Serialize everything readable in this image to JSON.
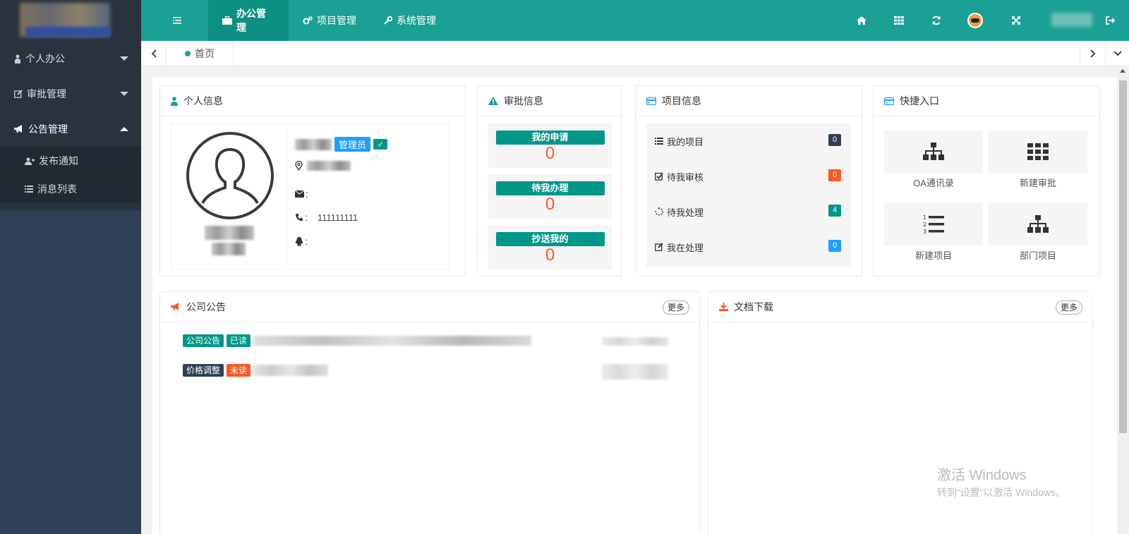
{
  "header": {
    "menu_icon": "hamburger-icon",
    "tabs": [
      {
        "label": "办公管理",
        "icon": "briefcase-icon",
        "active": true
      },
      {
        "label": "项目管理",
        "icon": "gears-icon",
        "active": false
      },
      {
        "label": "系统管理",
        "icon": "wrench-icon",
        "active": false
      }
    ],
    "tools": [
      "home-icon",
      "grid-icon",
      "refresh-icon",
      "avatar",
      "fullscreen-icon",
      "logout-icon"
    ]
  },
  "sidebar": {
    "items": [
      {
        "label": "个人办公",
        "icon": "person-icon",
        "expanded": false
      },
      {
        "label": "审批管理",
        "icon": "edit-icon",
        "expanded": false
      },
      {
        "label": "公告管理",
        "icon": "bullhorn-icon",
        "expanded": true
      }
    ],
    "subitems": [
      {
        "label": "发布通知",
        "icon": "user-plus-icon"
      },
      {
        "label": "消息列表",
        "icon": "list-icon"
      }
    ]
  },
  "tabbar": {
    "home": "首页"
  },
  "personal": {
    "title": "个人信息",
    "role_badge": "管理员",
    "gender_badge": "♂",
    "email_label": ":",
    "phone_label": ":",
    "phone": "111111111",
    "qq_label": ":"
  },
  "approval": {
    "title": "审批信息",
    "items": [
      {
        "label": "我的申请",
        "count": "0"
      },
      {
        "label": "待我办理",
        "count": "0"
      },
      {
        "label": "抄送我的",
        "count": "0"
      }
    ]
  },
  "project": {
    "title": "项目信息",
    "items": [
      {
        "label": "我的项目",
        "count": "0",
        "color": "#2f4056"
      },
      {
        "label": "待我审核",
        "count": "0",
        "color": "#ff5722"
      },
      {
        "label": "待我处理",
        "count": "4",
        "color": "#009688"
      },
      {
        "label": "我在处理",
        "count": "0",
        "color": "#1e9fff"
      }
    ]
  },
  "quick": {
    "title": "快捷入口",
    "items": [
      {
        "label": "OA通讯录",
        "icon": "org-chart-icon"
      },
      {
        "label": "新建审批",
        "icon": "grid-icon"
      },
      {
        "label": "新建项目",
        "icon": "ordered-list-icon"
      },
      {
        "label": "部门项目",
        "icon": "org-chart-icon"
      }
    ]
  },
  "notices": {
    "title": "公司公告",
    "more": "更多",
    "rows": [
      {
        "category": "公司公告",
        "category_color": "#009688",
        "status": "已读",
        "status_color": "#009688"
      },
      {
        "category": "价格调整",
        "category_color": "#2f4056",
        "status": "未读",
        "status_color": "#ff5722"
      }
    ]
  },
  "downloads": {
    "title": "文档下载",
    "more": "更多"
  },
  "watermark": {
    "line1": "激活 Windows",
    "line2": "转到“设置”以激活 Windows。"
  },
  "colors": {
    "primary": "#1aa094",
    "sidebar": "#28333e",
    "accent": "#ff5722",
    "info": "#1e9fff"
  }
}
